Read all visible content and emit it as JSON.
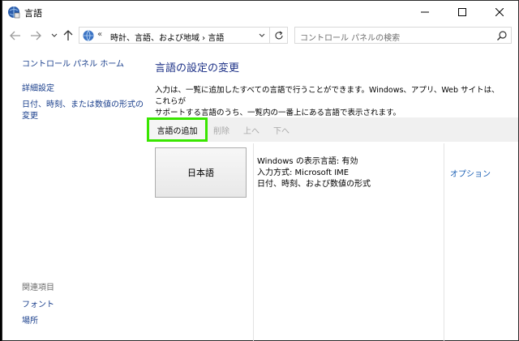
{
  "window": {
    "title": "言語"
  },
  "address": {
    "chevron": "«",
    "crumb": "時計、言語、および地域 › 言語"
  },
  "search": {
    "placeholder": "コントロール パネルの検索"
  },
  "sidebar": {
    "home": "コントロール パネル ホーム",
    "advanced": "詳細設定",
    "date_format": "日付、時刻、または数値の形式の変更",
    "date_format_line1": "日付、時刻、または数値の形式の",
    "date_format_line2": "変更",
    "related_header": "関連項目",
    "fonts": "フォント",
    "location": "場所"
  },
  "main": {
    "heading": "言語の設定の変更",
    "description_line1": "入力は、一覧に追加したすべての言語で行うことができます。Windows、アプリ、Web サイトは、これらが",
    "description_line2": "サポートする言語のうち、一覧内の一番上にある言語で表示されます。",
    "toolbar": {
      "add": "言語の追加",
      "remove": "削除",
      "up": "上へ",
      "down": "下へ"
    },
    "languages": [
      {
        "name": "日本語",
        "display_language": "Windows の表示言語: 有効",
        "input_method": "入力方式: Microsoft IME",
        "formats": "日付、時刻、および数値の形式",
        "options": "オプション"
      }
    ]
  },
  "colors": {
    "heading": "#1e3287",
    "link": "#1a3f8c",
    "highlight": "#39e600",
    "disabled": "#a8a8a8"
  }
}
